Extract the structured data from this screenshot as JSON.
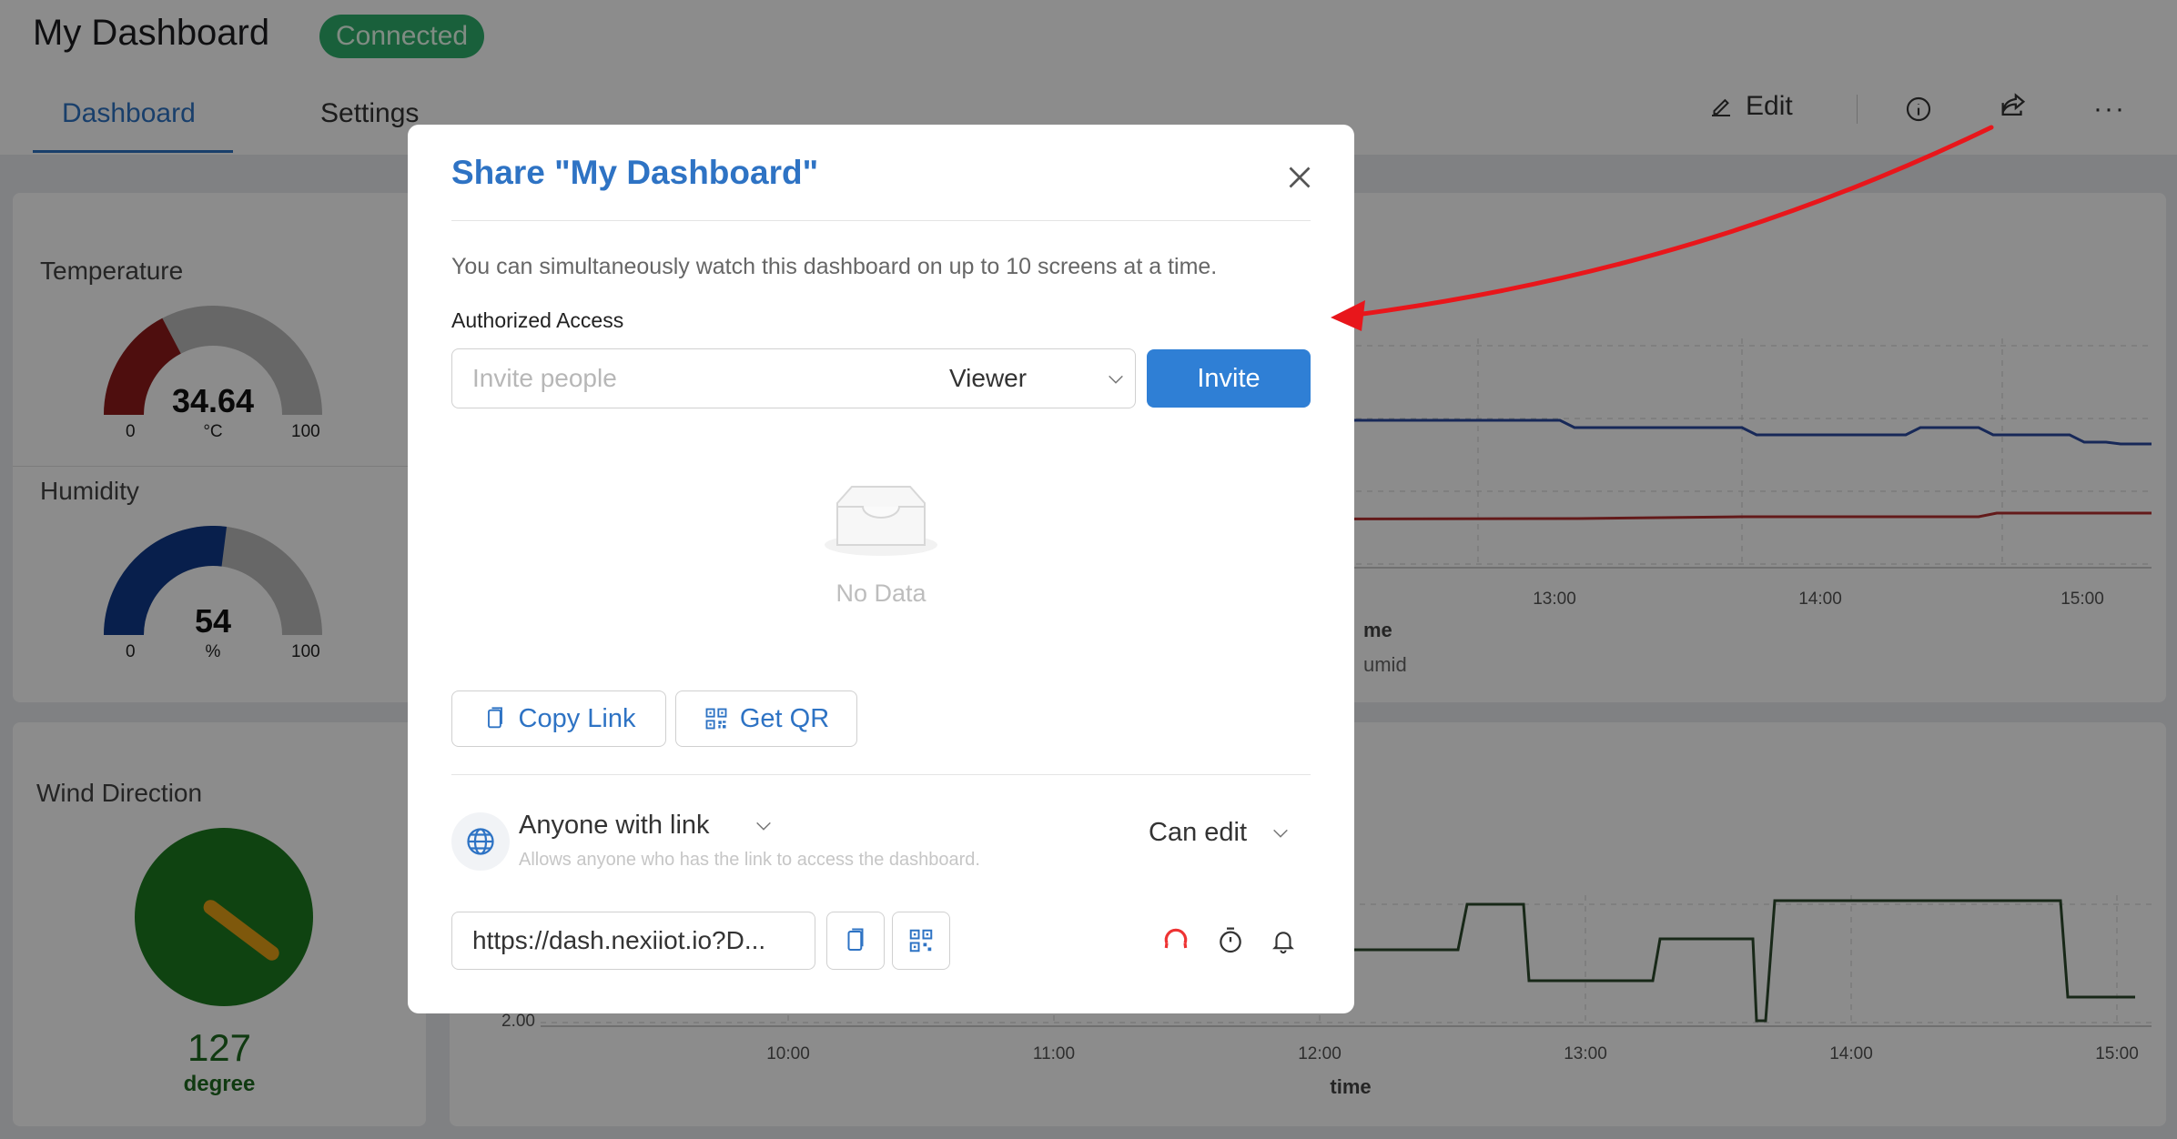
{
  "header": {
    "title": "My Dashboard",
    "status": "Connected",
    "tabs": [
      "Dashboard",
      "Settings"
    ],
    "edit_label": "Edit",
    "more_label": "···"
  },
  "widgets": {
    "temperature": {
      "title": "Temperature",
      "value": "34.64",
      "unit": "°C",
      "min": "0",
      "max": "100",
      "fraction": 0.3464,
      "color": "#8e1a1a"
    },
    "humidity": {
      "title": "Humidity",
      "value": "54",
      "unit": "%",
      "min": "0",
      "max": "100",
      "fraction": 0.54,
      "color": "#0f3a8a"
    },
    "wind": {
      "title": "Wind Direction",
      "value": "127",
      "unit": "degree",
      "angle_deg": 127
    }
  },
  "chart_data": [
    {
      "type": "line",
      "x_ticks": [
        "13:00",
        "14:00",
        "15:00"
      ],
      "xlabel": "me",
      "legend": [
        "umid"
      ],
      "series_colors": [
        "#2a4aa0",
        "#b53030"
      ]
    },
    {
      "type": "line",
      "x_ticks": [
        "10:00",
        "11:00",
        "12:00",
        "13:00",
        "14:00",
        "15:00"
      ],
      "y_ticks": [
        "2.00"
      ],
      "xlabel": "time",
      "series_colors": [
        "#2d4a2d"
      ]
    }
  ],
  "modal": {
    "title": "Share \"My Dashboard\"",
    "description": "You can simultaneously watch this dashboard on up to 10 screens at a time.",
    "section_label": "Authorized Access",
    "invite_placeholder": "Invite people",
    "role": "Viewer",
    "invite_button": "Invite",
    "empty_text": "No Data",
    "copy_link_label": "Copy Link",
    "get_qr_label": "Get QR",
    "access_label": "Anyone with link",
    "access_hint": "Allows anyone who has the link to access the dashboard.",
    "permission": "Can edit",
    "link_url": "https://dash.nexiiot.io?D..."
  },
  "colors": {
    "accent": "#2e73c4",
    "status_green": "#2fb06c",
    "arrow": "#e8161b",
    "refresh_icon": "#e33"
  }
}
